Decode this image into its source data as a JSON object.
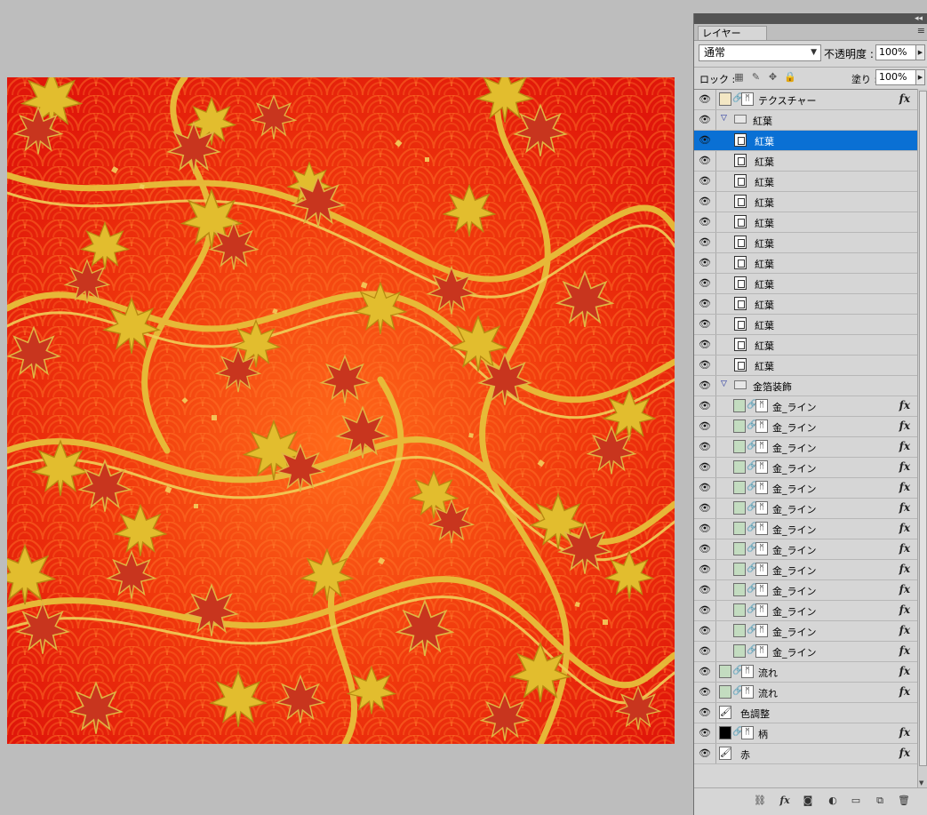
{
  "canvas": {
    "description_colors": {
      "base": "#e81a0a",
      "gold": "#d9b22a",
      "leaf": "#c43a1a"
    }
  },
  "panel": {
    "tab_label": "レイヤー",
    "blend_mode": "通常",
    "opacity_label": "不透明度 :",
    "opacity_value": "100%",
    "lock_label": "ロック :",
    "fill_label": "塗り :",
    "fill_value": "100%",
    "layers": [
      {
        "name": "テクスチャー",
        "kind": "layer",
        "thumb": "#f3e7c4",
        "link": true,
        "mask": true,
        "fx": true,
        "indent": 0
      },
      {
        "name": "紅葉",
        "kind": "group",
        "indent": 0
      },
      {
        "name": "紅葉",
        "kind": "smart",
        "indent": 1,
        "selected": true
      },
      {
        "name": "紅葉",
        "kind": "smart",
        "indent": 1
      },
      {
        "name": "紅葉",
        "kind": "smart",
        "indent": 1
      },
      {
        "name": "紅葉",
        "kind": "smart",
        "indent": 1
      },
      {
        "name": "紅葉",
        "kind": "smart",
        "indent": 1
      },
      {
        "name": "紅葉",
        "kind": "smart",
        "indent": 1
      },
      {
        "name": "紅葉",
        "kind": "smart",
        "indent": 1
      },
      {
        "name": "紅葉",
        "kind": "smart",
        "indent": 1
      },
      {
        "name": "紅葉",
        "kind": "smart",
        "indent": 1
      },
      {
        "name": "紅葉",
        "kind": "smart",
        "indent": 1
      },
      {
        "name": "紅葉",
        "kind": "smart",
        "indent": 1
      },
      {
        "name": "紅葉",
        "kind": "smart",
        "indent": 1
      },
      {
        "name": "金箔装飾",
        "kind": "group",
        "indent": 0
      },
      {
        "name": "金_ライン",
        "kind": "layer",
        "thumb": "#c3dcc0",
        "link": true,
        "mask": true,
        "fx": true,
        "indent": 1
      },
      {
        "name": "金_ライン",
        "kind": "layer",
        "thumb": "#c3dcc0",
        "link": true,
        "mask": true,
        "fx": true,
        "indent": 1
      },
      {
        "name": "金_ライン",
        "kind": "layer",
        "thumb": "#c3dcc0",
        "link": true,
        "mask": true,
        "fx": true,
        "indent": 1
      },
      {
        "name": "金_ライン",
        "kind": "layer",
        "thumb": "#c3dcc0",
        "link": true,
        "mask": true,
        "fx": true,
        "indent": 1
      },
      {
        "name": "金_ライン",
        "kind": "layer",
        "thumb": "#c3dcc0",
        "link": true,
        "mask": true,
        "fx": true,
        "indent": 1
      },
      {
        "name": "金_ライン",
        "kind": "layer",
        "thumb": "#c3dcc0",
        "link": true,
        "mask": true,
        "fx": true,
        "indent": 1
      },
      {
        "name": "金_ライン",
        "kind": "layer",
        "thumb": "#c3dcc0",
        "link": true,
        "mask": true,
        "fx": true,
        "indent": 1
      },
      {
        "name": "金_ライン",
        "kind": "layer",
        "thumb": "#c3dcc0",
        "link": true,
        "mask": true,
        "fx": true,
        "indent": 1
      },
      {
        "name": "金_ライン",
        "kind": "layer",
        "thumb": "#c3dcc0",
        "link": true,
        "mask": true,
        "fx": true,
        "indent": 1
      },
      {
        "name": "金_ライン",
        "kind": "layer",
        "thumb": "#c3dcc0",
        "link": true,
        "mask": true,
        "fx": true,
        "indent": 1
      },
      {
        "name": "金_ライン",
        "kind": "layer",
        "thumb": "#c3dcc0",
        "link": true,
        "mask": true,
        "fx": true,
        "indent": 1
      },
      {
        "name": "金_ライン",
        "kind": "layer",
        "thumb": "#c3dcc0",
        "link": true,
        "mask": true,
        "fx": true,
        "indent": 1
      },
      {
        "name": "金_ライン",
        "kind": "layer",
        "thumb": "#c3dcc0",
        "link": true,
        "mask": true,
        "fx": true,
        "indent": 1
      },
      {
        "name": "流れ",
        "kind": "layer",
        "thumb": "#c3dcc0",
        "link": true,
        "mask": true,
        "fx": true,
        "indent": 0
      },
      {
        "name": "流れ",
        "kind": "layer",
        "thumb": "#c3dcc0",
        "link": true,
        "mask": true,
        "fx": true,
        "indent": 0
      },
      {
        "name": "色調整",
        "kind": "adjustment",
        "indent": 0
      },
      {
        "name": "柄",
        "kind": "layer",
        "thumb": "#000000",
        "link": true,
        "mask": true,
        "fx": true,
        "indent": 0
      },
      {
        "name": "赤",
        "kind": "adjustment",
        "fx": true,
        "indent": 0
      }
    ]
  }
}
